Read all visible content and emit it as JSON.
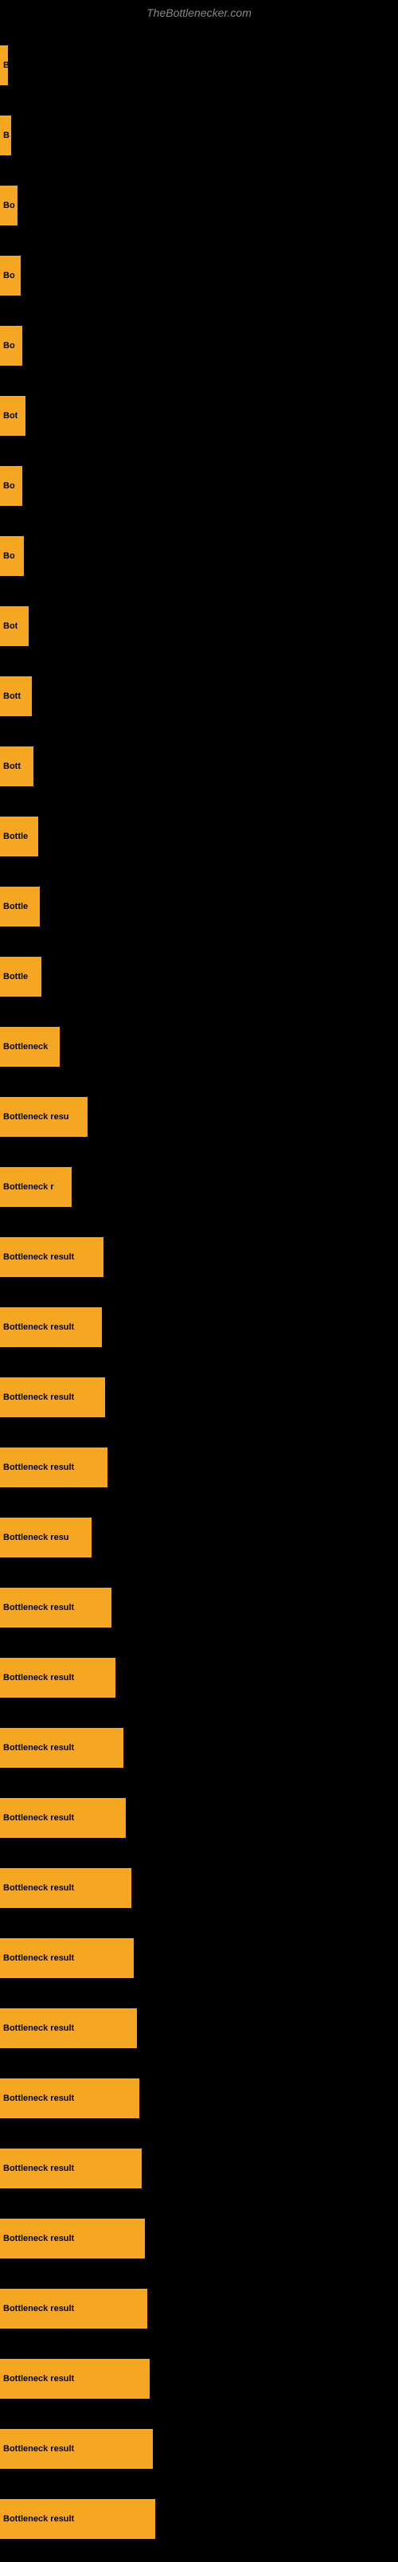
{
  "site": {
    "title": "TheBottlenecker.com"
  },
  "bars": [
    {
      "label": "",
      "text": "B",
      "width": 10
    },
    {
      "label": "",
      "text": "B",
      "width": 14
    },
    {
      "label": "",
      "text": "Bo",
      "width": 22
    },
    {
      "label": "",
      "text": "Bo",
      "width": 26
    },
    {
      "label": "",
      "text": "Bo",
      "width": 28
    },
    {
      "label": "",
      "text": "Bot",
      "width": 32
    },
    {
      "label": "",
      "text": "Bo",
      "width": 28
    },
    {
      "label": "",
      "text": "Bo",
      "width": 30
    },
    {
      "label": "",
      "text": "Bot",
      "width": 36
    },
    {
      "label": "",
      "text": "Bott",
      "width": 40
    },
    {
      "label": "",
      "text": "Bott",
      "width": 42
    },
    {
      "label": "",
      "text": "Bottle",
      "width": 48
    },
    {
      "label": "",
      "text": "Bottle",
      "width": 50
    },
    {
      "label": "",
      "text": "Bottle",
      "width": 52
    },
    {
      "label": "",
      "text": "Bottleneck",
      "width": 75
    },
    {
      "label": "",
      "text": "Bottleneck resu",
      "width": 110
    },
    {
      "label": "",
      "text": "Bottleneck r",
      "width": 90
    },
    {
      "label": "",
      "text": "Bottleneck result",
      "width": 130
    },
    {
      "label": "",
      "text": "Bottleneck result",
      "width": 128
    },
    {
      "label": "",
      "text": "Bottleneck result",
      "width": 132
    },
    {
      "label": "",
      "text": "Bottleneck result",
      "width": 135
    },
    {
      "label": "",
      "text": "Bottleneck resu",
      "width": 115
    },
    {
      "label": "",
      "text": "Bottleneck result",
      "width": 140
    },
    {
      "label": "",
      "text": "Bottleneck result",
      "width": 145
    },
    {
      "label": "",
      "text": "Bottleneck result",
      "width": 155
    },
    {
      "label": "",
      "text": "Bottleneck result",
      "width": 158
    },
    {
      "label": "",
      "text": "Bottleneck result",
      "width": 165
    },
    {
      "label": "",
      "text": "Bottleneck result",
      "width": 168
    },
    {
      "label": "",
      "text": "Bottleneck result",
      "width": 172
    },
    {
      "label": "",
      "text": "Bottleneck result",
      "width": 175
    },
    {
      "label": "",
      "text": "Bottleneck result",
      "width": 178
    },
    {
      "label": "",
      "text": "Bottleneck result",
      "width": 182
    },
    {
      "label": "",
      "text": "Bottleneck result",
      "width": 185
    },
    {
      "label": "",
      "text": "Bottleneck result",
      "width": 188
    },
    {
      "label": "",
      "text": "Bottleneck result",
      "width": 192
    },
    {
      "label": "",
      "text": "Bottleneck result",
      "width": 195
    }
  ]
}
